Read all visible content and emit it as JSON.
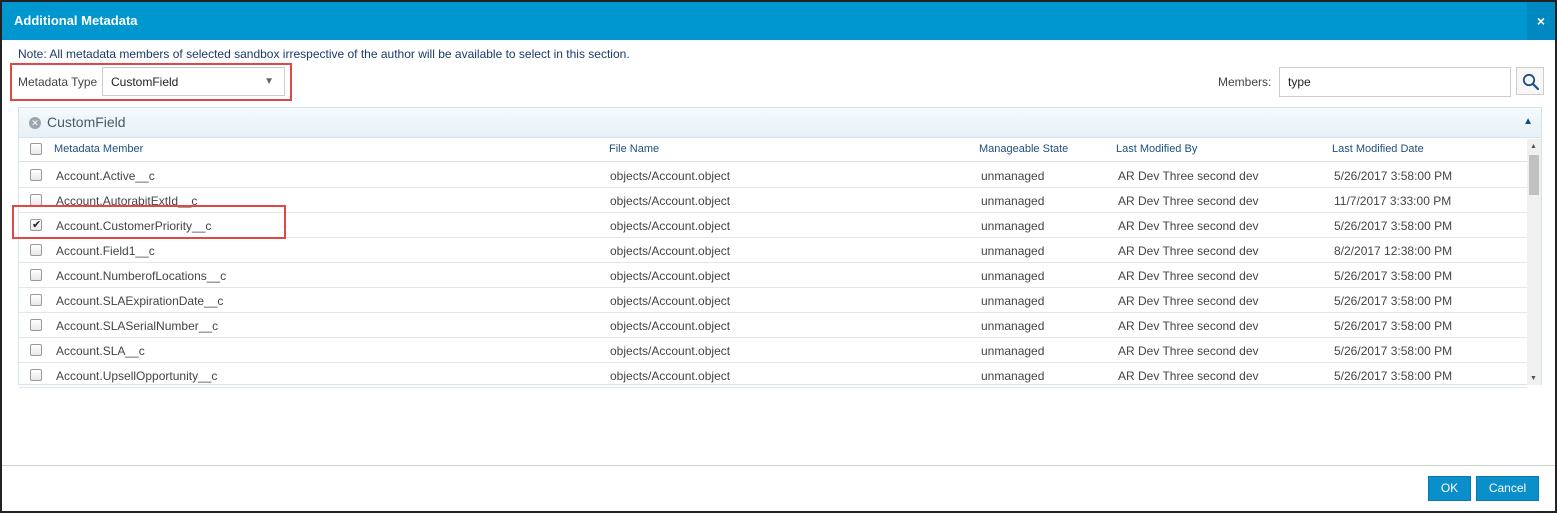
{
  "dialog": {
    "title": "Additional Metadata",
    "close_glyph": "×",
    "note": "Note: All metadata members of selected sandbox irrespective of the author will be available to select in this section."
  },
  "filters": {
    "metadata_type_label": "Metadata Type",
    "metadata_type_value": "CustomField",
    "members_label": "Members:",
    "members_value": "type"
  },
  "panel": {
    "title": "CustomField",
    "columns": [
      "Metadata Member",
      "File Name",
      "Manageable State",
      "Last Modified By",
      "Last Modified Date"
    ],
    "rows": [
      {
        "checked": false,
        "member": "Account.Active__c",
        "file": "objects/Account.object",
        "state": "unmanaged",
        "modified_by": "AR Dev Three second dev",
        "modified_date": "5/26/2017 3:58:00 PM"
      },
      {
        "checked": false,
        "member": "Account.AutorabitExtId__c",
        "file": "objects/Account.object",
        "state": "unmanaged",
        "modified_by": "AR Dev Three second dev",
        "modified_date": "11/7/2017 3:33:00 PM"
      },
      {
        "checked": true,
        "member": "Account.CustomerPriority__c",
        "file": "objects/Account.object",
        "state": "unmanaged",
        "modified_by": "AR Dev Three second dev",
        "modified_date": "5/26/2017 3:58:00 PM"
      },
      {
        "checked": false,
        "member": "Account.Field1__c",
        "file": "objects/Account.object",
        "state": "unmanaged",
        "modified_by": "AR Dev Three second dev",
        "modified_date": "8/2/2017 12:38:00 PM"
      },
      {
        "checked": false,
        "member": "Account.NumberofLocations__c",
        "file": "objects/Account.object",
        "state": "unmanaged",
        "modified_by": "AR Dev Three second dev",
        "modified_date": "5/26/2017 3:58:00 PM"
      },
      {
        "checked": false,
        "member": "Account.SLAExpirationDate__c",
        "file": "objects/Account.object",
        "state": "unmanaged",
        "modified_by": "AR Dev Three second dev",
        "modified_date": "5/26/2017 3:58:00 PM"
      },
      {
        "checked": false,
        "member": "Account.SLASerialNumber__c",
        "file": "objects/Account.object",
        "state": "unmanaged",
        "modified_by": "AR Dev Three second dev",
        "modified_date": "5/26/2017 3:58:00 PM"
      },
      {
        "checked": false,
        "member": "Account.SLA__c",
        "file": "objects/Account.object",
        "state": "unmanaged",
        "modified_by": "AR Dev Three second dev",
        "modified_date": "5/26/2017 3:58:00 PM"
      },
      {
        "checked": false,
        "member": "Account.UpsellOpportunity__c",
        "file": "objects/Account.object",
        "state": "unmanaged",
        "modified_by": "AR Dev Three second dev",
        "modified_date": "5/26/2017 3:58:00 PM"
      }
    ]
  },
  "buttons": {
    "ok": "OK",
    "cancel": "Cancel"
  },
  "colors": {
    "titlebar": "#0096cf",
    "highlight": "#e04848",
    "button": "#0a8fcb"
  }
}
